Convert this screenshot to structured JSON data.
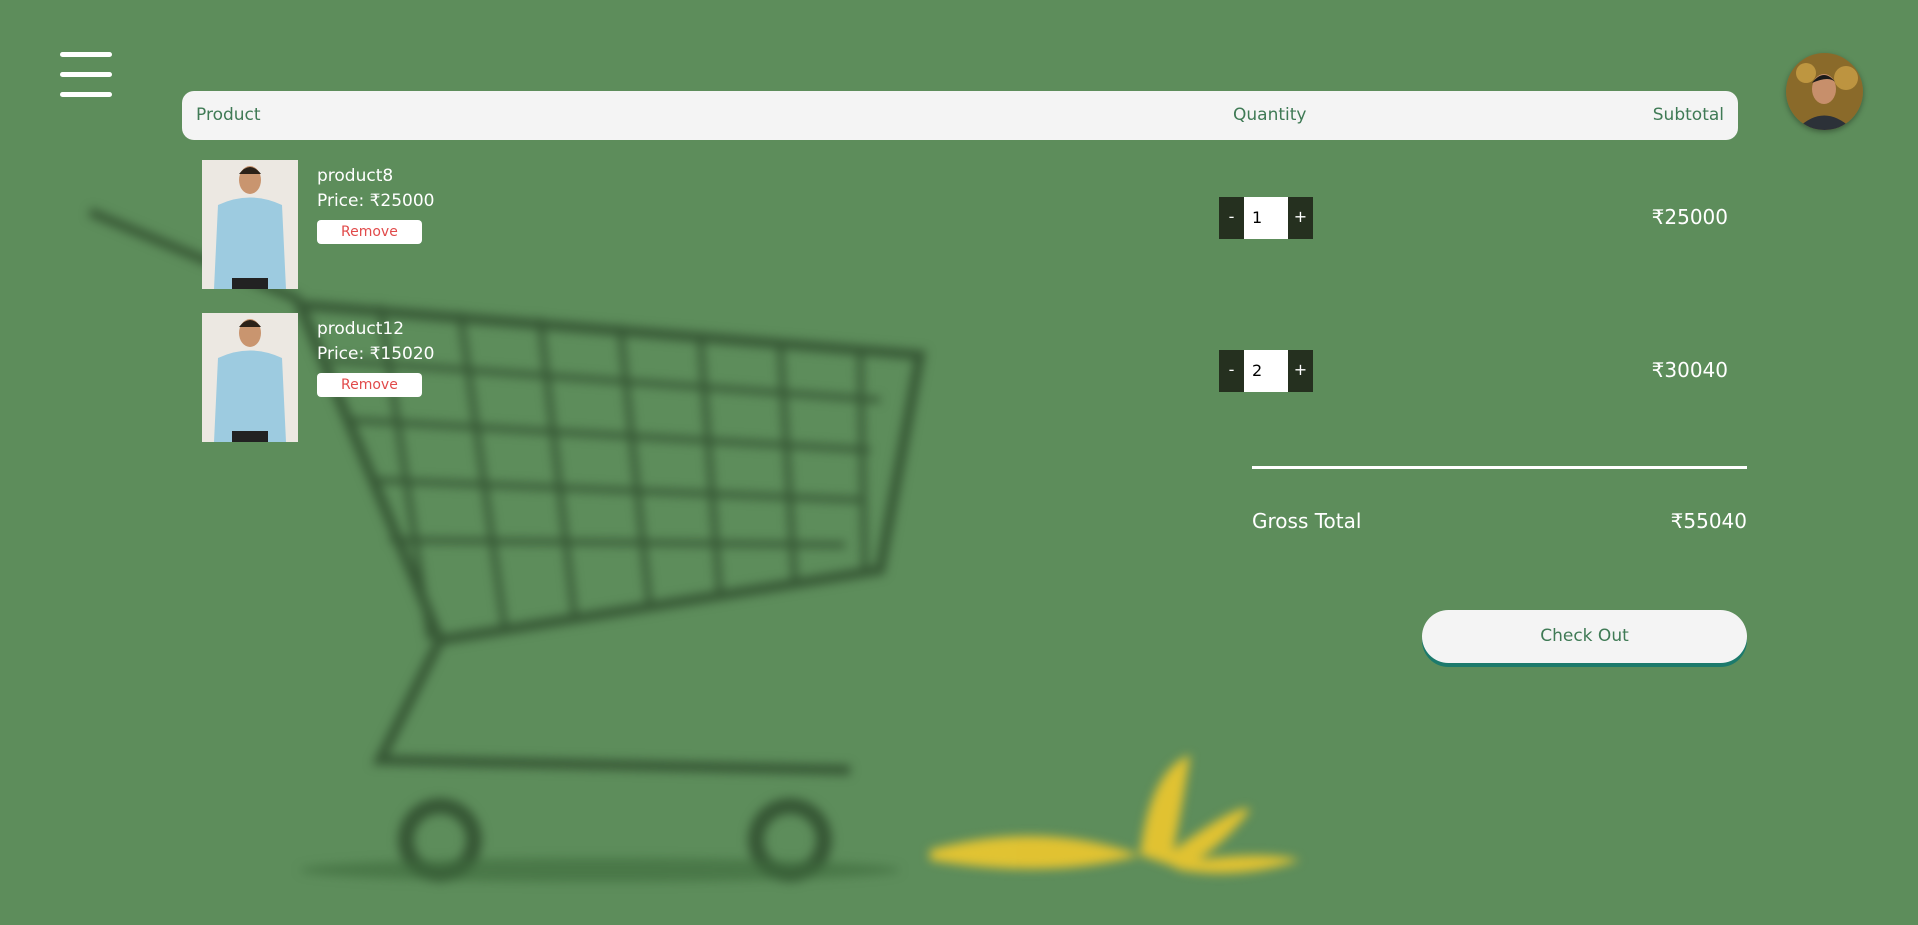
{
  "header": {
    "col_product": "Product",
    "col_quantity": "Quantity",
    "col_subtotal": "Subtotal"
  },
  "cart": {
    "items": [
      {
        "name": "product8",
        "price": "Price: ₹25000",
        "remove_label": "Remove",
        "qty_minus": "-",
        "quantity": "1",
        "qty_plus": "+",
        "subtotal": "₹25000"
      },
      {
        "name": "product12",
        "price": "Price: ₹15020",
        "remove_label": "Remove",
        "qty_minus": "-",
        "quantity": "2",
        "qty_plus": "+",
        "subtotal": "₹30040"
      }
    ]
  },
  "summary": {
    "gross_total_label": "Gross Total",
    "gross_total_value": "₹55040",
    "checkout_label": "Check Out"
  },
  "icons": {
    "menu": "hamburger-menu-icon",
    "avatar": "user-avatar"
  },
  "colors": {
    "background": "#5d8d5b",
    "header_bar": "#f4f4f4",
    "header_text": "#3f7a55",
    "remove_text": "#e14a4a",
    "qty_button": "#25301f",
    "checkout_shadow": "#1c7a6c"
  }
}
